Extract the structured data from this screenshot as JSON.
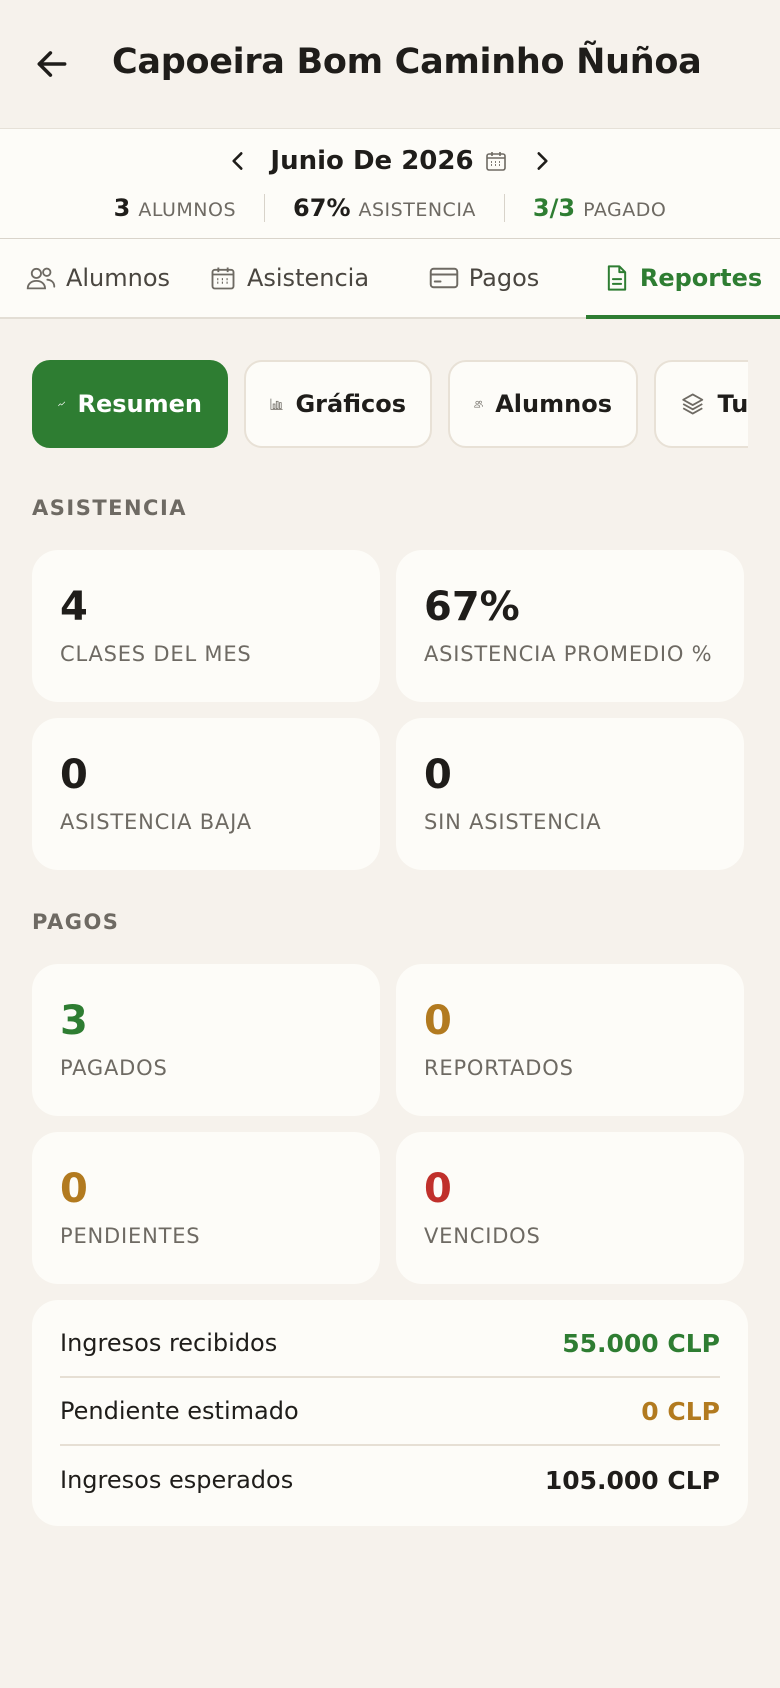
{
  "header": {
    "title": "Capoeira Bom Caminho Ñuñoa",
    "back_icon": "arrow-left-icon"
  },
  "summary": {
    "month": "Junio De 2026",
    "stats": [
      {
        "value": "3",
        "label": "ALUMNOS",
        "color": "#1f1d1a"
      },
      {
        "value": "67%",
        "label": "ASISTENCIA",
        "color": "#1f1d1a"
      },
      {
        "value": "3/3",
        "label": "PAGADO",
        "color": "#2e7d32"
      }
    ]
  },
  "tabs": [
    {
      "label": "Alumnos",
      "icon": "users-icon",
      "active": false
    },
    {
      "label": "Asistencia",
      "icon": "calendar-icon",
      "active": false
    },
    {
      "label": "Pagos",
      "icon": "credit-card-icon",
      "active": false
    },
    {
      "label": "Reportes",
      "icon": "document-icon",
      "active": true
    }
  ],
  "chips": [
    {
      "label": "Resumen",
      "icon": "trend-line-icon",
      "active": true
    },
    {
      "label": "Gráficos",
      "icon": "bar-chart-icon",
      "active": false
    },
    {
      "label": "Alumnos",
      "icon": "users-icon",
      "active": false
    },
    {
      "label": "Turnos",
      "icon": "layers-icon",
      "active": false
    }
  ],
  "attendance": {
    "title": "ASISTENCIA",
    "cards": [
      {
        "value": "4",
        "label": "CLASES DEL MES"
      },
      {
        "value": "67%",
        "label": "ASISTENCIA PROMEDIO %"
      },
      {
        "value": "0",
        "label": "ASISTENCIA BAJA"
      },
      {
        "value": "0",
        "label": "SIN ASISTENCIA"
      }
    ]
  },
  "payments": {
    "title": "PAGOS",
    "cards": [
      {
        "value": "3",
        "label": "PAGADOS",
        "color": "#2e7d32"
      },
      {
        "value": "0",
        "label": "REPORTADOS",
        "color": "#b27a1f"
      },
      {
        "value": "0",
        "label": "PENDIENTES",
        "color": "#b27a1f"
      },
      {
        "value": "0",
        "label": "VENCIDOS",
        "color": "#c0302b"
      }
    ]
  },
  "revenue": [
    {
      "label": "Ingresos recibidos",
      "value": "55.000 CLP",
      "color": "#2e7d32"
    },
    {
      "label": "Pendiente estimado",
      "value": "0 CLP",
      "color": "#b27a1f"
    },
    {
      "label": "Ingresos esperados",
      "value": "105.000 CLP",
      "color": "#1f1d1a"
    }
  ]
}
